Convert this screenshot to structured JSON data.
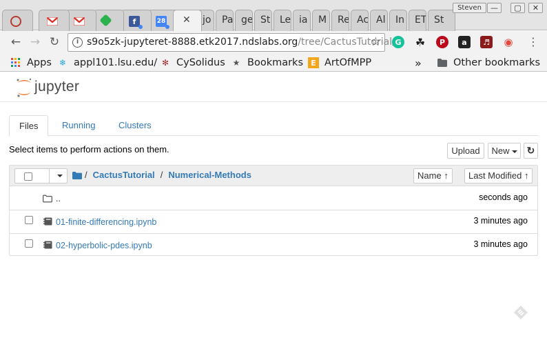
{
  "browser": {
    "tabs": [
      {
        "kind": "icon",
        "icon": "lsu-icon",
        "color": "#b83a2e"
      },
      {
        "kind": "icon",
        "icon": "gmail-icon",
        "color": "#d93025"
      },
      {
        "kind": "icon",
        "icon": "gmail-icon",
        "color": "#d93025"
      },
      {
        "kind": "icon",
        "icon": "feedly-icon",
        "color": "#2bb24c"
      },
      {
        "kind": "icon",
        "icon": "facebook-icon",
        "color": "#3b5998"
      },
      {
        "kind": "icon",
        "icon": "calendar-icon",
        "color": "#4285f4",
        "text": "28"
      },
      {
        "kind": "active",
        "icon": "close-icon"
      },
      {
        "kind": "text",
        "text": "jo"
      },
      {
        "kind": "text",
        "text": "Pa"
      },
      {
        "kind": "text",
        "text": "ge"
      },
      {
        "kind": "text",
        "text": "St"
      },
      {
        "kind": "text",
        "text": "Le"
      },
      {
        "kind": "text",
        "text": "ia"
      },
      {
        "kind": "text",
        "text": "M"
      },
      {
        "kind": "text",
        "text": "Re"
      },
      {
        "kind": "text",
        "text": "Ac"
      },
      {
        "kind": "text",
        "text": "Al"
      },
      {
        "kind": "text",
        "text": "In"
      },
      {
        "kind": "text",
        "text": "ET"
      },
      {
        "kind": "text",
        "text": "St"
      }
    ],
    "profile_name": "Steven",
    "url_host": "s9o5zk-jupyteret-8888.etk2017.ndslabs.org",
    "url_path": "/tree/CactusTutorial/",
    "bookmarks": [
      {
        "label": "Apps",
        "icon": "apps-icon"
      },
      {
        "label": "appl101.lsu.edu/",
        "icon": "lsu-bookmark-icon"
      },
      {
        "label": "CySolidus",
        "icon": "cysolidus-icon"
      },
      {
        "label": "Bookmarks",
        "icon": "star-icon"
      },
      {
        "label": "ArtOfMPP",
        "icon": "artofmpp-icon"
      }
    ],
    "overflow": "»",
    "other_bookmarks": "Other bookmarks"
  },
  "jupyter": {
    "brand": "jupyter",
    "tabs": [
      "Files",
      "Running",
      "Clusters"
    ],
    "active_tab": "Files",
    "instructions": "Select items to perform actions on them.",
    "upload_label": "Upload",
    "new_label": "New",
    "breadcrumb_sep": "/",
    "breadcrumb": [
      "CactusTutorial",
      "Numerical-Methods"
    ],
    "sort_name": "Name",
    "sort_modified": "Last Modified",
    "rows": [
      {
        "name": "..",
        "type": "folder",
        "modified": "seconds ago"
      },
      {
        "name": "01-finite-differencing.ipynb",
        "type": "notebook",
        "modified": "3 minutes ago"
      },
      {
        "name": "02-hyperbolic-pdes.ipynb",
        "type": "notebook",
        "modified": "3 minutes ago"
      }
    ]
  },
  "colors": {
    "link": "#337ab7",
    "jupyter_orange": "#f37726"
  }
}
